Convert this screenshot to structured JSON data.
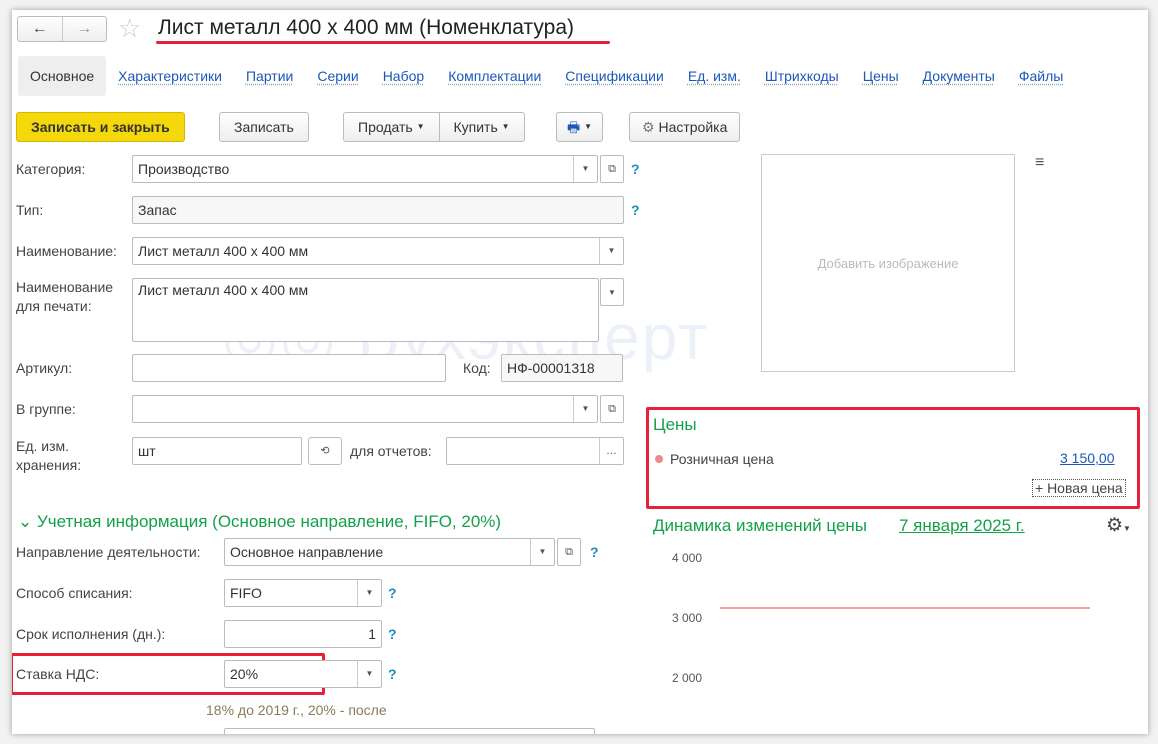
{
  "header": {
    "back": "←",
    "forward": "→",
    "title": "Лист металл 400 х 400 мм (Номенклатура)"
  },
  "tabs": [
    "Основное",
    "Характеристики",
    "Партии",
    "Серии",
    "Набор",
    "Комплектации",
    "Спецификации",
    "Ед. изм.",
    "Штрихкоды",
    "Цены",
    "Документы",
    "Файлы"
  ],
  "toolbar": {
    "save_close": "Записать и закрыть",
    "save": "Записать",
    "sell": "Продать",
    "buy": "Купить",
    "settings": "Настройка"
  },
  "form": {
    "category_label": "Категория:",
    "category": "Производство",
    "type_label": "Тип:",
    "type": "Запас",
    "name_label": "Наименование:",
    "name": "Лист металл 400 х 400 мм",
    "print_name_label": "Наименование для печати:",
    "print_name": "Лист металл 400 х 400 мм",
    "article_label": "Артикул:",
    "article": "",
    "code_label": "Код:",
    "code": "НФ-00001318",
    "group_label": "В группе:",
    "group": "",
    "unit_label": "Ед. изм. хранения:",
    "unit": "шт",
    "report_unit_label": "для отчетов:",
    "report_unit": "",
    "help": "?",
    "image_placeholder": "Добавить изображение"
  },
  "accounting": {
    "header": "Учетная информация (Основное направление, FIFO, 20%)",
    "direction_label": "Направление деятельности:",
    "direction": "Основное направление",
    "writeoff_label": "Способ списания:",
    "writeoff": "FIFO",
    "term_label": "Срок исполнения (дн.):",
    "term": "1",
    "vat_label": "Ставка НДС:",
    "vat": "20%",
    "vat_hint": "18% до 2019 г., 20% - после"
  },
  "prices": {
    "title": "Цены",
    "items": [
      {
        "name": "Розничная цена",
        "value": "3 150,00"
      }
    ],
    "new_price": "+ Новая цена"
  },
  "watermark": "Бухэксперт",
  "chart_data": {
    "type": "line",
    "title": "Динамика изменений цены",
    "date_link": "7 января 2025 г.",
    "yticks": [
      "4 000",
      "3 000",
      "2 000"
    ],
    "ylim": [
      1000,
      4000
    ],
    "series": [
      {
        "name": "Розничная цена",
        "values": [
          3150,
          3150
        ],
        "color": "#f4a0a0"
      }
    ]
  }
}
